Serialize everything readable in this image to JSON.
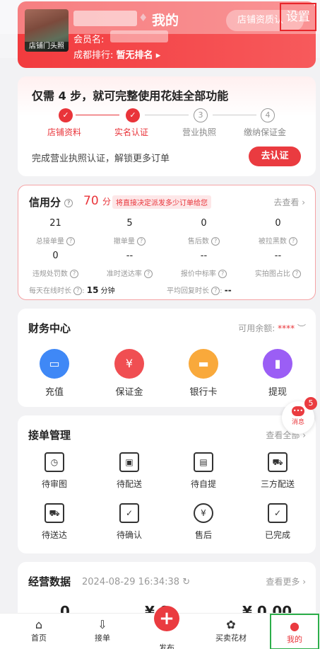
{
  "header": {
    "store_image_label": "店铺门头照",
    "title": "我的",
    "qualification": "店铺资质认",
    "settings": "设置",
    "member_label": "会员名:",
    "rank_label": "成都排行:",
    "rank_value": "暂无排名"
  },
  "steps": {
    "title": "仅需 4 步，就可完整使用花娃全部功能",
    "items": [
      {
        "n": "✓",
        "label": "店铺资料",
        "done": true
      },
      {
        "n": "✓",
        "label": "实名认证",
        "done": true
      },
      {
        "n": "3",
        "label": "营业执照",
        "done": false
      },
      {
        "n": "4",
        "label": "缴纳保证金",
        "done": false
      }
    ],
    "hint": "完成营业执照认证，解锁更多订单",
    "button": "去认证"
  },
  "credit": {
    "title": "信用分",
    "score": "70",
    "unit": "分",
    "tag": "将直接决定派发多少订单给您",
    "more": "去查看",
    "metrics": [
      {
        "v": "21",
        "l": "总接单量"
      },
      {
        "v": "5",
        "l": "撤单量"
      },
      {
        "v": "0",
        "l": "售后数"
      },
      {
        "v": "0",
        "l": "被拉黑数"
      },
      {
        "v": "0",
        "l": "违规处罚数"
      },
      {
        "v": "--",
        "l": "准时送达率"
      },
      {
        "v": "--",
        "l": "报价中标率"
      },
      {
        "v": "--",
        "l": "实拍图占比"
      }
    ],
    "online_label": "每天在线时长",
    "online_value": "15",
    "online_unit": "分钟",
    "reply_label": "平均回复时长",
    "reply_value": "--"
  },
  "finance": {
    "title": "财务中心",
    "balance_label": "可用余额:",
    "balance_value": "****",
    "items": [
      "充值",
      "保证金",
      "银行卡",
      "提现"
    ]
  },
  "orders": {
    "title": "接单管理",
    "more": "查看全部",
    "items": [
      "待审图",
      "待配送",
      "待自提",
      "三方配送",
      "待送达",
      "待确认",
      "售后",
      "已完成"
    ]
  },
  "message": {
    "label": "消息",
    "badge": "5"
  },
  "biz": {
    "title": "经营数据",
    "date": "2024-08-29 16:34:38",
    "more": "查看更多",
    "v1": "0",
    "v2": "¥ 0",
    "v3": "¥ 0.00"
  },
  "tabs": [
    "首页",
    "接单",
    "发布",
    "买卖花材",
    "我的"
  ],
  "colors": {
    "accent": "#ea3b40",
    "active_outline": "#2cae4a"
  }
}
